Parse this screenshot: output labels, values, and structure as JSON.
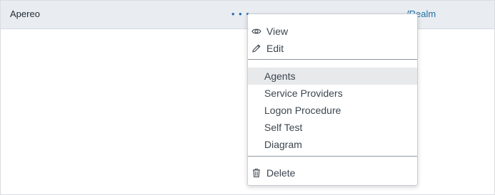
{
  "row": {
    "name": "Apereo",
    "actions_glyph": "• • •",
    "realm_text": "/Realm"
  },
  "menu": {
    "view_label": "View",
    "edit_label": "Edit",
    "agents_label": "Agents",
    "service_providers_label": "Service Providers",
    "logon_procedure_label": "Logon Procedure",
    "self_test_label": "Self Test",
    "diagram_label": "Diagram",
    "delete_label": "Delete",
    "icons": {
      "view": "eye-icon",
      "edit": "pencil-icon",
      "delete": "trash-icon"
    }
  },
  "colors": {
    "row_background": "#e9edf1",
    "link_blue": "#1e6fa8",
    "menu_text": "#3c4650",
    "hover_background": "#e7e9eb"
  }
}
